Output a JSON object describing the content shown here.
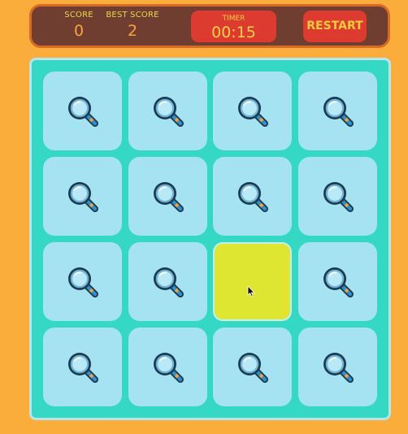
{
  "scoreboard": {
    "score_label": "SCORE",
    "score_value": "0",
    "best_label": "BEST SCORE",
    "best_value": "2",
    "timer_label": "TIMER",
    "timer_value": "00:15",
    "restart_label": "RESTART"
  },
  "board": {
    "rows": 4,
    "cols": 4,
    "card_back_icon": "magnifying-glass-icon",
    "flipped_card": {
      "row": 3,
      "col": 3,
      "color": "#dee631"
    }
  },
  "colors": {
    "background": "#fbad3b",
    "header": "#703d31",
    "header_border": "#d66a27",
    "button": "#dd3b30",
    "board": "#35d9c3",
    "card": "#a5e3f3"
  }
}
